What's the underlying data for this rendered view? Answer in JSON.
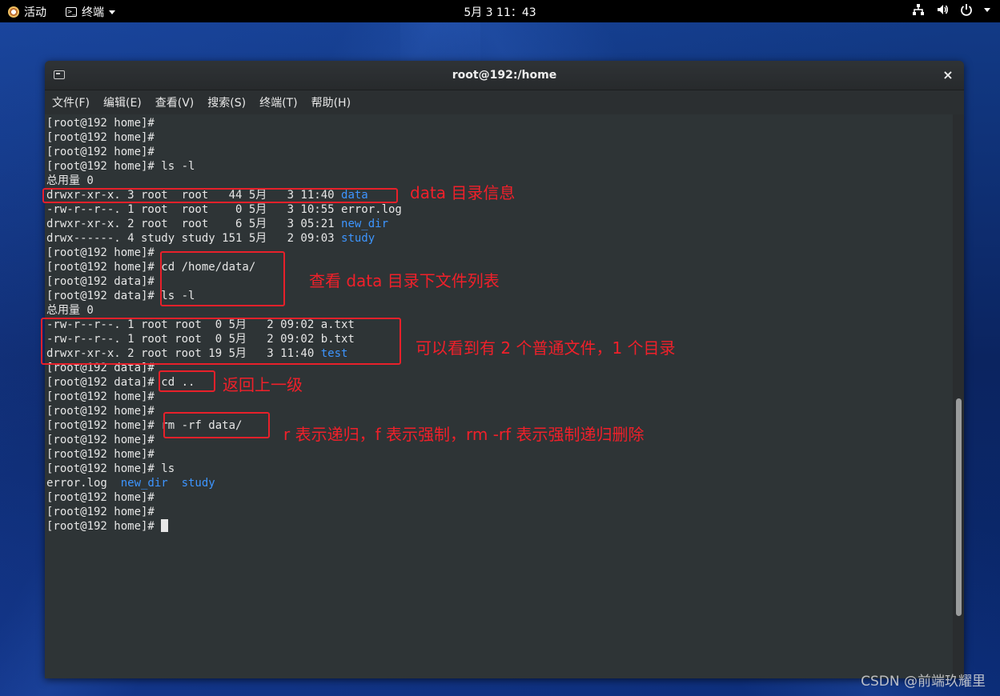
{
  "topbar": {
    "activities": "活动",
    "app_name": "终端",
    "clock": "5月 3  11：43"
  },
  "window": {
    "title": "root@192:/home",
    "close_glyph": "×",
    "menu": [
      "文件(F)",
      "编辑(E)",
      "查看(V)",
      "搜索(S)",
      "终端(T)",
      "帮助(H)"
    ]
  },
  "terminal": {
    "lines": [
      "[root@192 home]#",
      "[root@192 home]#",
      "[root@192 home]#",
      "[root@192 home]# ls -l",
      "总用量 0",
      {
        "pre": "drwxr-xr-x. 3 root  root   44 5月   3 11:40 ",
        "blue": "data"
      },
      "-rw-r--r--. 1 root  root    0 5月   3 10:55 error.log",
      {
        "pre": "drwxr-xr-x. 2 root  root    6 5月   3 05:21 ",
        "blue": "new_dir"
      },
      {
        "pre": "drwx------. 4 study study 151 5月   2 09:03 ",
        "blue": "study"
      },
      "[root@192 home]#",
      "[root@192 home]# cd /home/data/",
      "[root@192 data]#",
      "[root@192 data]# ls -l",
      "总用量 0",
      "-rw-r--r--. 1 root root  0 5月   2 09:02 a.txt",
      "-rw-r--r--. 1 root root  0 5月   2 09:02 b.txt",
      {
        "pre": "drwxr-xr-x. 2 root root 19 5月   3 11:40 ",
        "blue": "test"
      },
      "[root@192 data]#",
      "[root@192 data]# cd ..",
      "[root@192 home]#",
      "[root@192 home]#",
      "[root@192 home]# rm -rf data/",
      "[root@192 home]#",
      "[root@192 home]#",
      "[root@192 home]# ls",
      {
        "pre": "error.log  ",
        "blue": "new_dir  study"
      },
      "[root@192 home]#",
      "[root@192 home]#",
      {
        "pre": "[root@192 home]# ",
        "cursor": true
      }
    ]
  },
  "annotations": {
    "data_info": "data 目录信息",
    "view_list": "查看 data 目录下文件列表",
    "summary": "可以看到有 2 个普通文件，1 个目录",
    "go_up": "返回上一级",
    "rm_explain": "r 表示递归，f 表示强制，rm -rf 表示强制递归删除"
  },
  "watermark": "CSDN @前端玖耀里",
  "colors": {
    "terminal_bg": "#2e3436",
    "directory_blue": "#3d95ff",
    "annotation_red": "#e8202a"
  }
}
